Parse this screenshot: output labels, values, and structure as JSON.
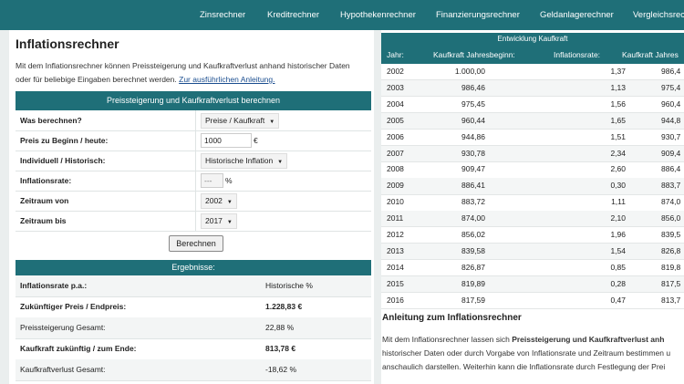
{
  "nav": [
    "Zinsrechner",
    "Kreditrechner",
    "Hypothekenrechner",
    "Finanzierungsrechner",
    "Geldanlagerechner",
    "Vergleichsrechner"
  ],
  "title": "Inflationsrechner",
  "intro": {
    "line1": "Mit dem Inflationsrechner können Preissteigerung und Kaufkraftverlust anhand historischer Daten",
    "line2": "oder für beliebige Eingaben berechnet werden.",
    "link": "Zur ausführlichen Anleitung."
  },
  "form": {
    "header": "Preissteigerung und Kaufkraftverlust berechnen",
    "rows": {
      "was": {
        "label": "Was berechnen?",
        "value": "Preise / Kaufkraft"
      },
      "preis": {
        "label": "Preis zu Beginn / heute:",
        "value": "1000",
        "unit": "€"
      },
      "modus": {
        "label": "Individuell / Historisch:",
        "value": "Historische Inflation"
      },
      "rate": {
        "label": "Inflationsrate:",
        "value": "---",
        "unit": "%"
      },
      "von": {
        "label": "Zeitraum von",
        "value": "2002"
      },
      "bis": {
        "label": "Zeitraum bis",
        "value": "2017"
      }
    },
    "button": "Berechnen"
  },
  "results": {
    "header": "Ergebnisse:",
    "rows": [
      {
        "label": "Inflationsrate p.a.:",
        "value": "Historische %"
      },
      {
        "label": "Zukünftiger Preis / Endpreis:",
        "value": "1.228,83 €"
      },
      {
        "label": "Preissteigerung Gesamt:",
        "value": "22,88 %"
      },
      {
        "label": "Kaufkraft zukünftig / zum Ende:",
        "value": "813,78 €"
      },
      {
        "label": "Kaufkraftverlust Gesamt:",
        "value": "-18,62 %"
      }
    ]
  },
  "table": {
    "title": "Entwicklung Kaufkraft",
    "columns": [
      "Jahr:",
      "Kaufkraft Jahresbeginn:",
      "Inflationsrate:",
      "Kaufkraft Jahres"
    ],
    "rows": [
      [
        "2002",
        "1.000,00",
        "1,37",
        "986,4"
      ],
      [
        "2003",
        "986,46",
        "1,13",
        "975,4"
      ],
      [
        "2004",
        "975,45",
        "1,56",
        "960,4"
      ],
      [
        "2005",
        "960,44",
        "1,65",
        "944,8"
      ],
      [
        "2006",
        "944,86",
        "1,51",
        "930,7"
      ],
      [
        "2007",
        "930,78",
        "2,34",
        "909,4"
      ],
      [
        "2008",
        "909,47",
        "2,60",
        "886,4"
      ],
      [
        "2009",
        "886,41",
        "0,30",
        "883,7"
      ],
      [
        "2010",
        "883,72",
        "1,11",
        "874,0"
      ],
      [
        "2011",
        "874,00",
        "2,10",
        "856,0"
      ],
      [
        "2012",
        "856,02",
        "1,96",
        "839,5"
      ],
      [
        "2013",
        "839,58",
        "1,54",
        "826,8"
      ],
      [
        "2014",
        "826,87",
        "0,85",
        "819,8"
      ],
      [
        "2015",
        "819,89",
        "0,28",
        "817,5"
      ],
      [
        "2016",
        "817,59",
        "0,47",
        "813,7"
      ]
    ]
  },
  "anleitung": {
    "title": "Anleitung zum Inflationsrechner",
    "line1_pre": "Mit dem Inflationsrechner lassen sich ",
    "line1_bold": "Preissteigerung und Kaufkraftverlust anh",
    "line2": "historischer Daten oder durch Vorgabe von Inflationsrate und Zeitraum bestimmen u",
    "line3": "anschaulich darstellen. Weiterhin kann die Inflationsrate durch Festlegung der Prei"
  }
}
